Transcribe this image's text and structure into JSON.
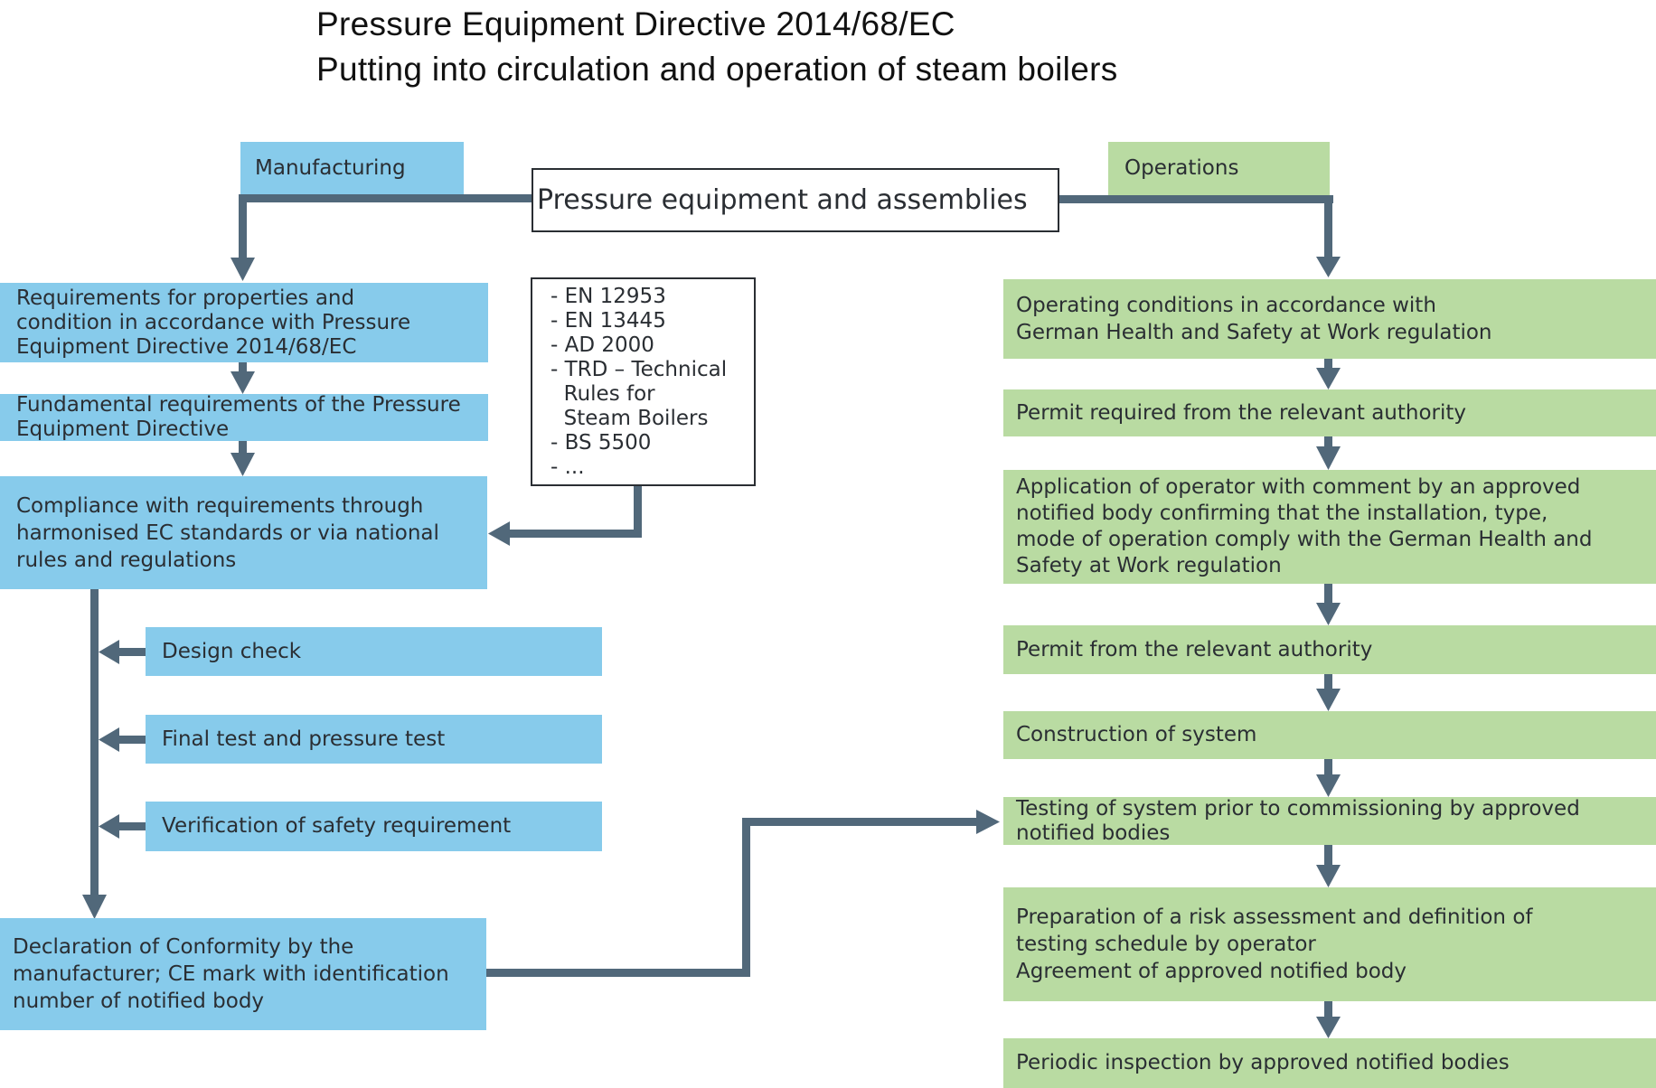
{
  "title": {
    "line1": "Pressure Equipment Directive 2014/68/EC",
    "line2": "Putting into circulation and operation of steam boilers"
  },
  "center": {
    "label": "Pressure equipment and assemblies"
  },
  "colors": {
    "manufacturing": "#87cbeb",
    "operations": "#b9dba2",
    "connector": "#51687a"
  },
  "manufacturing": {
    "header": "Manufacturing",
    "steps": [
      "Requirements for properties and\ncondition in accordance with Pressure\nEquipment Directive 2014/68/EC",
      "Fundamental requirements of the Pressure\nEquipment Directive",
      "Compliance with requirements through\nharmonised EC standards or via national\nrules and regulations"
    ],
    "checks": [
      "Design check",
      "Final test and pressure test",
      "Verification of safety requirement"
    ],
    "declaration": "Declaration of Conformity by the\nmanufacturer; CE mark with identification\nnumber of notified body"
  },
  "standards": {
    "items": [
      "- EN 12953",
      "- EN 13445",
      "- AD 2000",
      "- TRD – Technical",
      "  Rules for",
      "  Steam Boilers",
      "- BS 5500",
      "- ..."
    ]
  },
  "operations": {
    "header": "Operations",
    "steps": [
      "Operating conditions in accordance with\nGerman Health and Safety at Work regulation",
      "Permit required from the relevant authority",
      "Application of operator with comment by an approved\nnotified body confirming that the installation, type,\nmode of operation comply with the German Health and\nSafety at Work regulation",
      "Permit from the relevant authority",
      "Construction of system",
      "Testing of system prior to commissioning by approved\nnotified bodies",
      "Preparation of a risk assessment and definition of\ntesting schedule by operator\nAgreement of approved notified body",
      "Periodic inspection by approved notified bodies"
    ]
  }
}
